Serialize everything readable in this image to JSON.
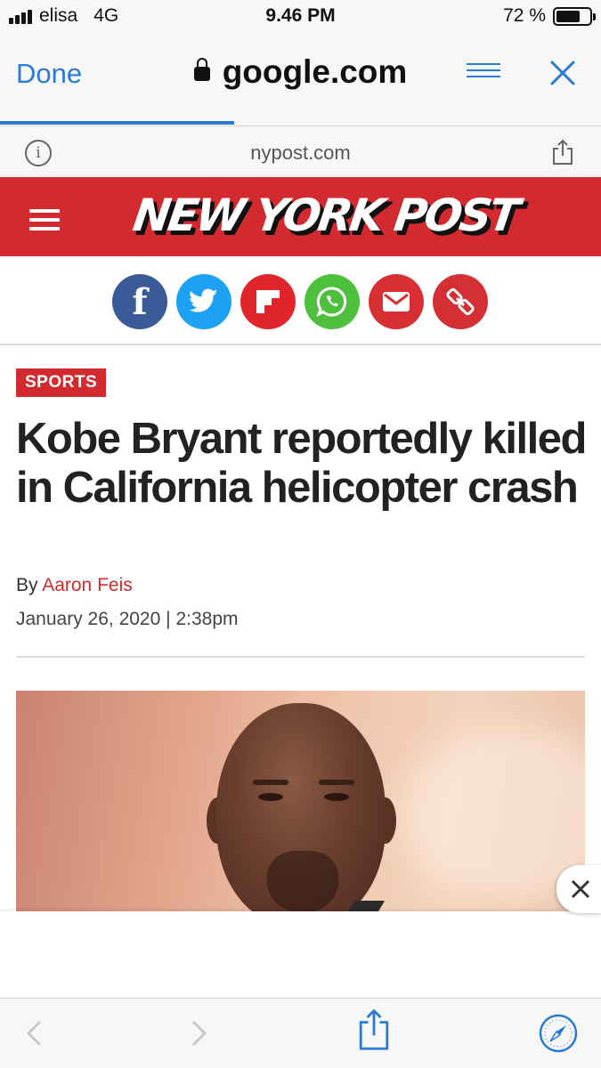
{
  "status_bar": {
    "carrier": "elisa",
    "network": "4G",
    "time": "9.46 PM",
    "battery_percent": "72 %",
    "battery_level": 0.72
  },
  "nav": {
    "done_label": "Done",
    "domain": "google.com",
    "load_progress": 0.39
  },
  "site_bar": {
    "url": "nypost.com"
  },
  "header": {
    "logo_text": "NEW YORK POST"
  },
  "share_buttons": [
    "facebook-icon",
    "twitter-icon",
    "flipboard-icon",
    "whatsapp-icon",
    "email-icon",
    "link-icon"
  ],
  "article": {
    "section": "SPORTS",
    "headline": "Kobe Bryant reportedly killed in California helicopter crash",
    "byline_prefix": "By",
    "author": "Aaron Feis",
    "date": "January 26, 2020",
    "separator": "|",
    "time": "2:38pm"
  },
  "colors": {
    "accent_blue": "#2a7ad6",
    "nyp_red": "#d22a2e",
    "facebook": "#3a5a98",
    "twitter": "#1da1f2",
    "flipboard": "#e0262c",
    "whatsapp": "#4fc03d",
    "email": "#d72f33",
    "link": "#d32f34"
  }
}
